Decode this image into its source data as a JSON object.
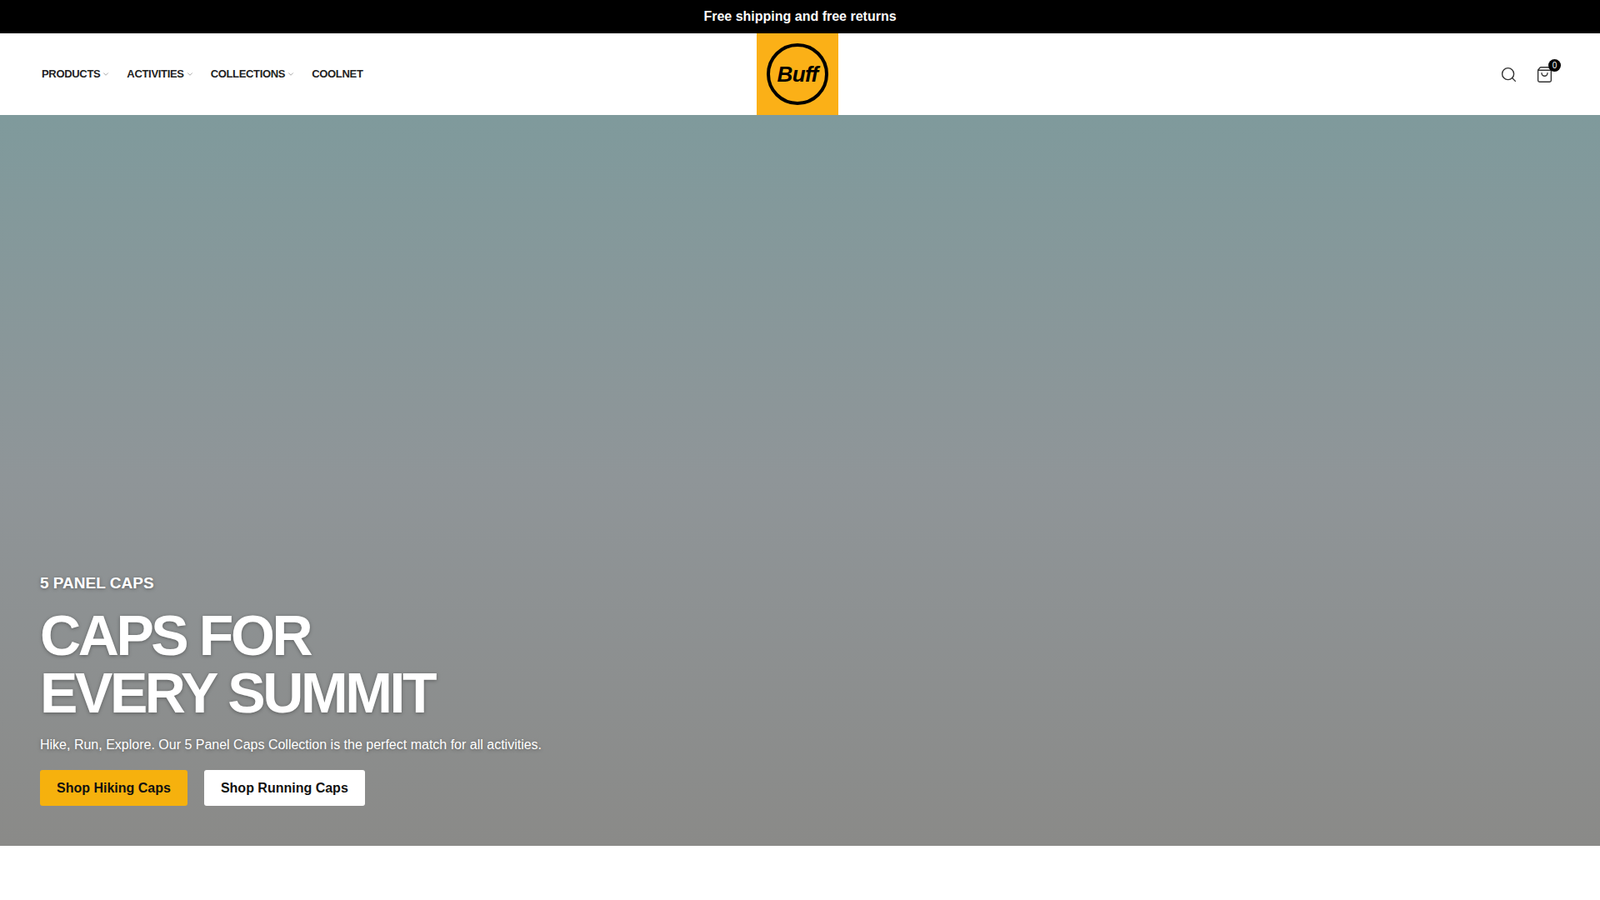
{
  "announcement": "Free shipping and free returns",
  "nav": [
    {
      "label": "PRODUCTS",
      "dropdown": true
    },
    {
      "label": "ACTIVITIES",
      "dropdown": true
    },
    {
      "label": "COLLECTIONS",
      "dropdown": true
    },
    {
      "label": "COOLNET",
      "dropdown": false
    }
  ],
  "logo": {
    "text": "Buff"
  },
  "cart": {
    "count": "0"
  },
  "hero": {
    "eyebrow": "5 PANEL CAPS",
    "heading": [
      "CAPS FOR",
      "EVERY SUMMIT"
    ],
    "text": "Hike, Run, Explore. Our 5 Panel Caps Collection is the perfect match for all activities.",
    "buttons": [
      {
        "label": "Shop Hiking Caps",
        "kind": "primary"
      },
      {
        "label": "Shop Running Caps",
        "kind": "secondary"
      }
    ]
  }
}
